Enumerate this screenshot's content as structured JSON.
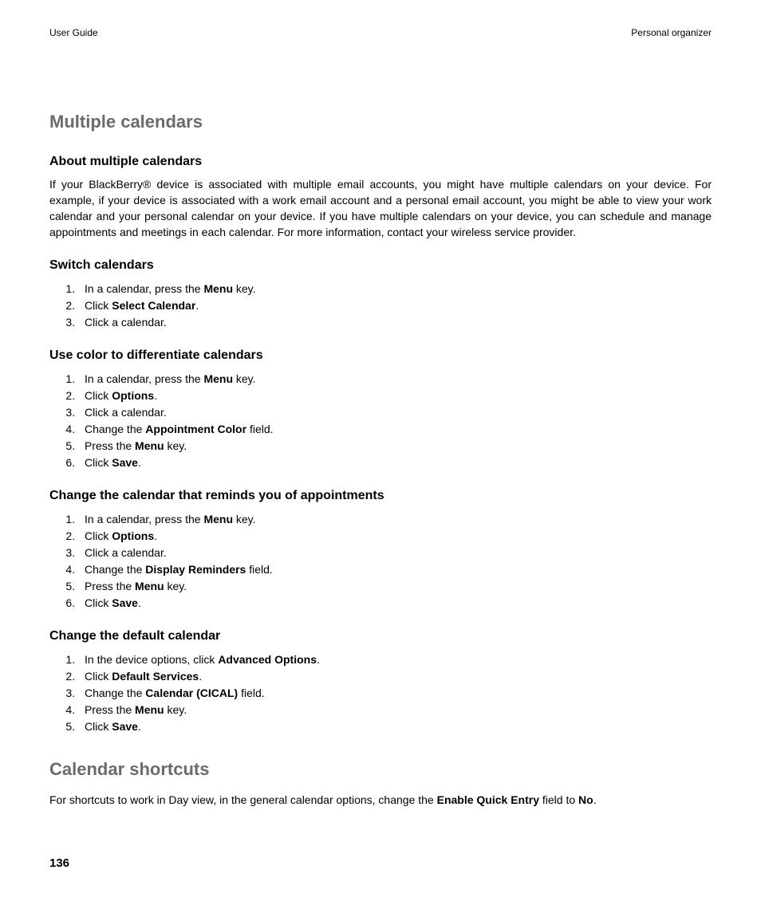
{
  "header": {
    "left": "User Guide",
    "right": "Personal organizer"
  },
  "section1": {
    "title": "Multiple calendars",
    "sub1": {
      "title": "About multiple calendars",
      "para": "If your BlackBerry® device is associated with multiple email accounts, you might have multiple calendars on your device. For example, if your device is associated with a work email account and a personal email account, you might be able to view your work calendar and your personal calendar on your device. If you have multiple calendars on your device, you can schedule and manage appointments and meetings in each calendar. For more information, contact your wireless service provider."
    },
    "sub2": {
      "title": "Switch calendars",
      "step1a": "In a calendar, press the ",
      "step1b": "Menu",
      "step1c": " key.",
      "step2a": "Click ",
      "step2b": "Select Calendar",
      "step2c": ".",
      "step3": "Click a calendar."
    },
    "sub3": {
      "title": "Use color to differentiate calendars",
      "step1a": "In a calendar, press the ",
      "step1b": "Menu",
      "step1c": " key.",
      "step2a": "Click ",
      "step2b": "Options",
      "step2c": ".",
      "step3": "Click a calendar.",
      "step4a": "Change the ",
      "step4b": "Appointment Color",
      "step4c": " field.",
      "step5a": "Press the ",
      "step5b": "Menu",
      "step5c": " key.",
      "step6a": "Click ",
      "step6b": "Save",
      "step6c": "."
    },
    "sub4": {
      "title": "Change the calendar that reminds you of appointments",
      "step1a": "In a calendar, press the ",
      "step1b": "Menu",
      "step1c": " key.",
      "step2a": "Click ",
      "step2b": "Options",
      "step2c": ".",
      "step3": "Click a calendar.",
      "step4a": "Change the ",
      "step4b": "Display Reminders",
      "step4c": " field.",
      "step5a": "Press the ",
      "step5b": "Menu",
      "step5c": " key.",
      "step6a": "Click ",
      "step6b": "Save",
      "step6c": "."
    },
    "sub5": {
      "title": "Change the default calendar",
      "step1a": "In the device options, click ",
      "step1b": "Advanced Options",
      "step1c": ".",
      "step2a": "Click ",
      "step2b": "Default Services",
      "step2c": ".",
      "step3a": "Change the ",
      "step3b": "Calendar (CICAL)",
      "step3c": " field.",
      "step4a": "Press the ",
      "step4b": "Menu",
      "step4c": " key.",
      "step5a": "Click ",
      "step5b": "Save",
      "step5c": "."
    }
  },
  "section2": {
    "title": "Calendar shortcuts",
    "para_a": "For shortcuts to work in Day view, in the general calendar options, change the ",
    "para_b": "Enable Quick Entry",
    "para_c": " field to ",
    "para_d": "No",
    "para_e": "."
  },
  "footer": {
    "page": "136"
  }
}
